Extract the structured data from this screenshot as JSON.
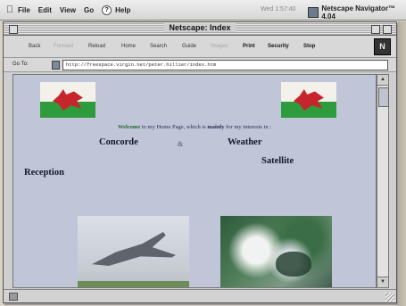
{
  "menubar": {
    "items": [
      "File",
      "Edit",
      "View",
      "Go",
      "Help"
    ],
    "clock": "Wed 1:57:40",
    "app_name": "Netscape Navigator™ 4.04"
  },
  "window": {
    "title": "Netscape: Index"
  },
  "toolbar": {
    "buttons": [
      "Back",
      "Forward",
      "Reload",
      "Home",
      "Search",
      "Guide",
      "Images",
      "Print",
      "Security",
      "Stop"
    ],
    "logo": "N"
  },
  "location": {
    "label": "Go To:",
    "url": "http://freespace.virgin.net/peter.hillier/index.htm"
  },
  "page": {
    "welcome_prefix": "Welcome",
    "welcome_middle": " to my Home Page, which is ",
    "welcome_bold": "mainly",
    "welcome_suffix": " for my interests in :",
    "concorde": "Concorde",
    "amp": "&",
    "weather": "Weather",
    "satellite": "Satellite",
    "reception": "Reception"
  },
  "colors": {
    "page_bg": "#c1c5d8",
    "welsh_red": "#c7252d",
    "welsh_green": "#2e9b3c"
  },
  "icons": {
    "apple": "apple-icon",
    "help": "help-icon",
    "scroll_up": "up-arrow-icon",
    "scroll_down": "down-arrow-icon"
  }
}
